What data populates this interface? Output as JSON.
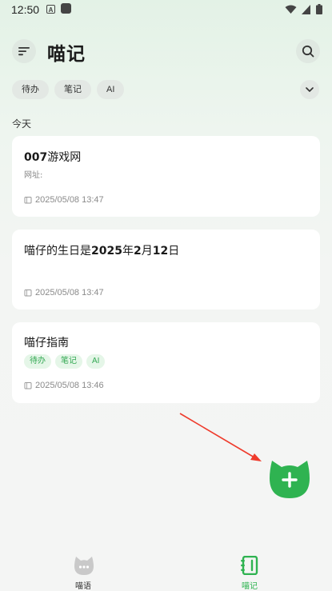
{
  "status_bar": {
    "time": "12:50",
    "notif_letter": "A"
  },
  "header": {
    "title": "喵记"
  },
  "filters": [
    "待办",
    "笔记",
    "AI"
  ],
  "section_label": "今天",
  "notes": [
    {
      "title_bold": "007",
      "title_rest": "游戏网",
      "subtitle": "网址:",
      "date": "2025/05/08 13:47"
    },
    {
      "title_parts": [
        "喵仔的生日是",
        "2025",
        "年",
        "2",
        "月",
        "12",
        "日"
      ],
      "date": "2025/05/08 13:47"
    },
    {
      "title": "喵仔指南",
      "tags": [
        "待办",
        "笔记",
        "AI"
      ],
      "date": "2025/05/08 13:46"
    }
  ],
  "bottom_nav": [
    {
      "label": "喵语",
      "active": false
    },
    {
      "label": "喵记",
      "active": true
    }
  ],
  "colors": {
    "accent": "#2fb351",
    "arrow": "#ef3b2c"
  }
}
